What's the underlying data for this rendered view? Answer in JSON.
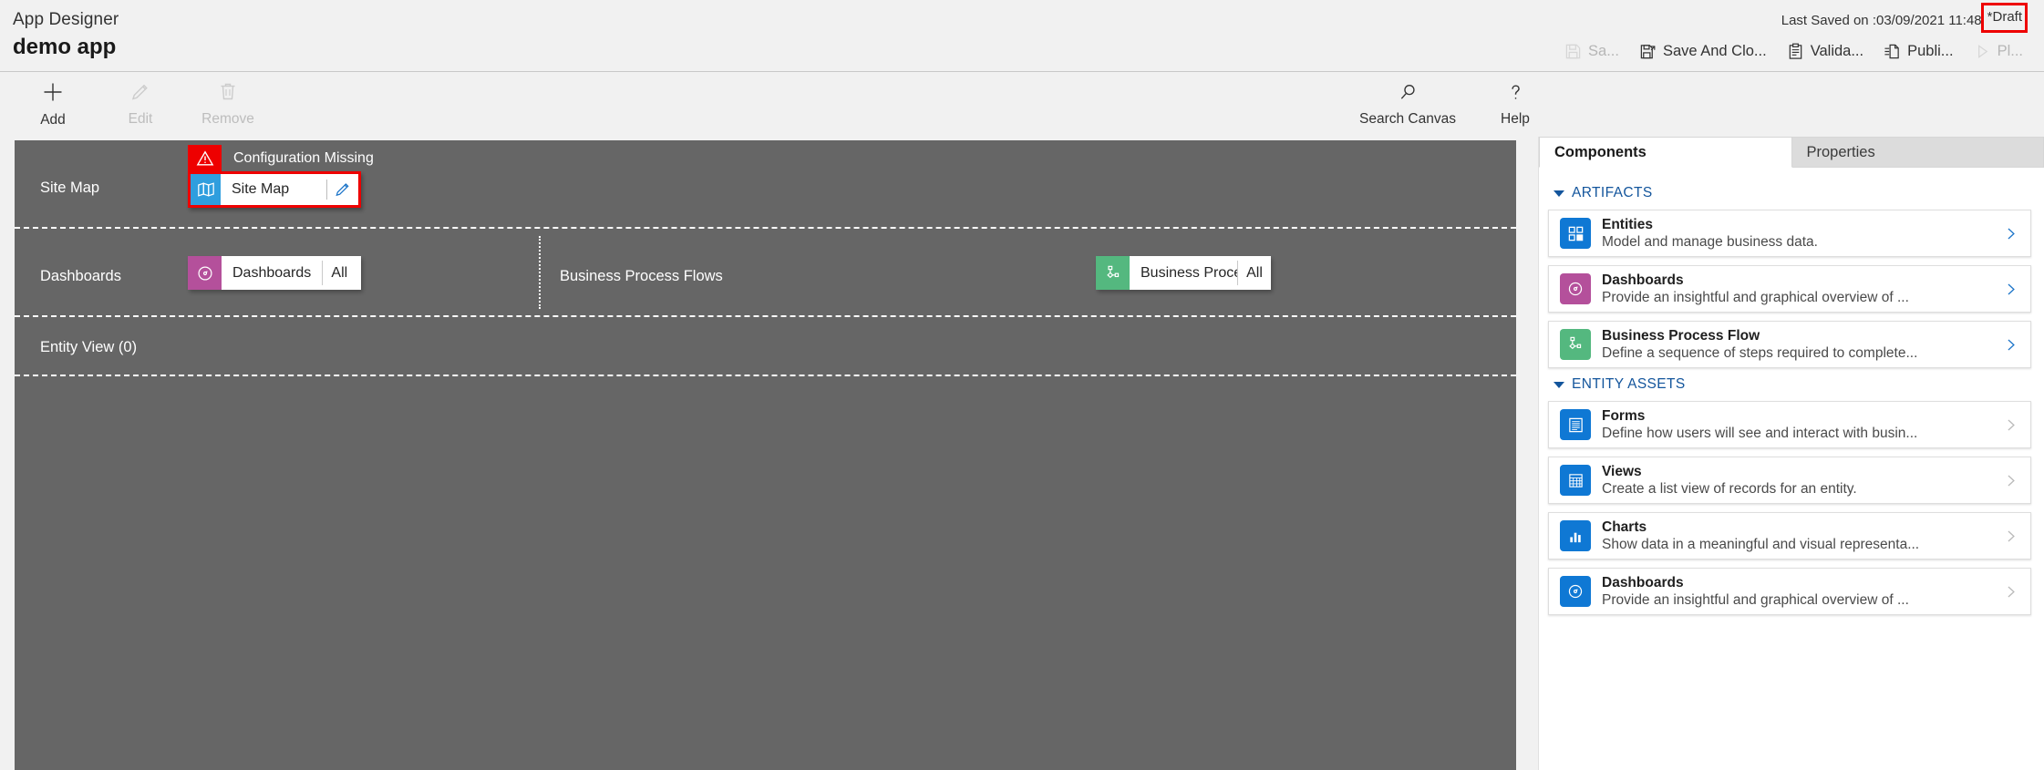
{
  "header": {
    "product_label": "App Designer",
    "app_name": "demo app",
    "last_saved": "Last Saved on :03/09/2021 11:48",
    "draft_status": "*Draft",
    "draft_highlight_color": "#ee0000",
    "commands": [
      {
        "label": "Sa...",
        "icon": "save-icon",
        "disabled": true
      },
      {
        "label": "Save And Clo...",
        "icon": "save-and-close-icon",
        "disabled": false
      },
      {
        "label": "Valida...",
        "icon": "validate-icon",
        "disabled": false
      },
      {
        "label": "Publi...",
        "icon": "publish-icon",
        "disabled": false
      },
      {
        "label": "Pl...",
        "icon": "play-icon",
        "disabled": true
      }
    ]
  },
  "toolbar": {
    "left": [
      {
        "label": "Add",
        "icon": "plus-icon",
        "disabled": false
      },
      {
        "label": "Edit",
        "icon": "pencil-icon",
        "disabled": true
      },
      {
        "label": "Remove",
        "icon": "trash-icon",
        "disabled": true
      }
    ],
    "right": [
      {
        "label": "Search Canvas",
        "icon": "search-icon",
        "disabled": false
      },
      {
        "label": "Help",
        "icon": "question-mark-icon",
        "disabled": false
      }
    ]
  },
  "canvas": {
    "background_color": "#666666",
    "rows": {
      "sitemap": {
        "label": "Site Map",
        "warning": "Configuration Missing",
        "warning_color": "#ee0000",
        "tile": {
          "name": "Site Map",
          "icon": "map-icon",
          "icon_color": "#2f9ede",
          "edit_icon": "pencil-icon",
          "selected": true
        }
      },
      "dashboards": {
        "label": "Dashboards",
        "tile": {
          "name": "Dashboards",
          "scope": "All",
          "icon": "dashboard-gauge-icon",
          "icon_color": "#b4509b"
        }
      },
      "business_process_flows": {
        "label": "Business Process Flows",
        "tile": {
          "name": "Business Proces...",
          "scope": "All",
          "icon": "process-flow-icon",
          "icon_color": "#54b87f"
        }
      },
      "entity_view": {
        "label": "Entity View (0)"
      }
    }
  },
  "right_panel": {
    "tabs": [
      {
        "label": "Components",
        "active": true
      },
      {
        "label": "Properties",
        "active": false
      }
    ],
    "groups": [
      {
        "title": "ARTIFACTS",
        "expanded": true,
        "cards": [
          {
            "title": "Entities",
            "subtitle": "Model and manage business data.",
            "icon": "entities-icon",
            "icon_color": "#0f78d4",
            "chevron_enabled": true
          },
          {
            "title": "Dashboards",
            "subtitle": "Provide an insightful and graphical overview of ...",
            "icon": "dashboard-gauge-icon",
            "icon_color": "#b4509b",
            "chevron_enabled": true
          },
          {
            "title": "Business Process Flow",
            "subtitle": "Define a sequence of steps required to complete...",
            "icon": "process-flow-icon",
            "icon_color": "#54b87f",
            "chevron_enabled": true
          }
        ]
      },
      {
        "title": "ENTITY ASSETS",
        "expanded": true,
        "cards": [
          {
            "title": "Forms",
            "subtitle": "Define how users will see and interact with busin...",
            "icon": "forms-icon",
            "icon_color": "#0f78d4",
            "chevron_enabled": false
          },
          {
            "title": "Views",
            "subtitle": "Create a list view of records for an entity.",
            "icon": "views-grid-icon",
            "icon_color": "#0f78d4",
            "chevron_enabled": false
          },
          {
            "title": "Charts",
            "subtitle": "Show data in a meaningful and visual representa...",
            "icon": "charts-bar-icon",
            "icon_color": "#0f78d4",
            "chevron_enabled": false
          },
          {
            "title": "Dashboards",
            "subtitle": "Provide an insightful and graphical overview of ...",
            "icon": "dashboard-gauge-icon",
            "icon_color": "#0f78d4",
            "chevron_enabled": false
          }
        ]
      }
    ]
  }
}
